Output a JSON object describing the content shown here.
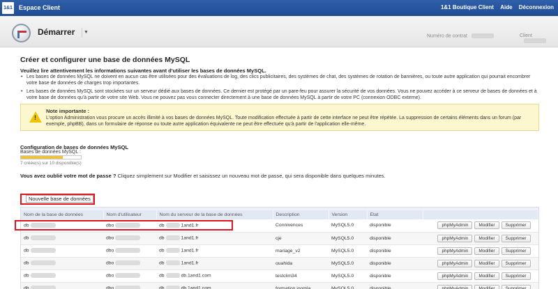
{
  "topbar": {
    "logo": "1&1",
    "title": "Espace Client",
    "links": [
      "1&1 Boutique Client",
      "Aide",
      "Déconnexion"
    ],
    "bg_color": "#1f4c95"
  },
  "header": {
    "start_label": "Démarrer",
    "contract_label": "Numéro de contrat",
    "client_label": "Client"
  },
  "main": {
    "title": "Créer et configurer une base de données MySQL",
    "warning_lead": "Veuillez lire attentivement les informations suivantes avant d'utiliser les bases de données MySQL.",
    "bullet1": "Les bases de données MySQL ne doivent en aucun cas être utilisées pour des évaluations de log, des clics publicitaires, des systèmes de chat, des systèmes de rotation de bannières, ou toute autre application qui pourrait encombrer votre base de données de charges trop importantes.",
    "bullet2": "Les bases de données MySQL sont stockées sur un serveur dédié aux bases de données. Ce dernier est protégé par un pare-feu pour assurer la sécurité de vos données. Vous ne pouvez accéder à ce serveur de bases de données et à votre base de données qu'à partir de votre site Web. Vous ne pouvez pas vous connecter directement à une base de données MySQL à partir de votre PC (connexion ODBC externe).",
    "note_title": "Note importante :",
    "note_text": "L'option Administration vous procure un accès illimité à vos bases de données MySQL. Toute modification effectuée à partir de cette interface ne peut être répétée. La suppression de certains éléments dans un forum (par exemple, phpBB), dans un formulaire de réponse ou toute autre application équivalente ne peut être effectuée qu'à partir de l'application elle-même.",
    "config_title": "Configuration de bases de données MySQL",
    "config_label": "Bases de données MySQL :",
    "config_count": "7 créée(s) sur 10 disponible(s)",
    "config_fill_fraction": 0.7,
    "forgot_question": "Vous avez oublié votre mot de passe ?",
    "forgot_text": "Cliquez simplement sur Modifier et saisissez un nouveau mot de passe, qui sera disponible dans quelques minutes.",
    "new_db_button": "Nouvelle base de données"
  },
  "table": {
    "headers": [
      "Nom de la base de données",
      "Nom d'utilisateur",
      "Nom du serveur de la base de données",
      "Description",
      "Version",
      "Etat",
      ""
    ],
    "rows": [
      {
        "db": "db",
        "user": "dbo",
        "server_prefix": "db",
        "server_suffix": "1and1.fr",
        "desc": "Connivences",
        "version": "MySQL5.0",
        "state": "disponible"
      },
      {
        "db": "db",
        "user": "dbo",
        "server_prefix": "db",
        "server_suffix": "1and1.fr",
        "desc": "cje",
        "version": "MySQL5.0",
        "state": "disponible"
      },
      {
        "db": "db",
        "user": "dbo",
        "server_prefix": "db",
        "server_suffix": "1and1.fr",
        "desc": "mariage_v2",
        "version": "MySQL5.0",
        "state": "disponible"
      },
      {
        "db": "db",
        "user": "dbo",
        "server_prefix": "db",
        "server_suffix": "1and1.fr",
        "desc": "ouahida",
        "version": "MySQL5.0",
        "state": "disponible"
      },
      {
        "db": "db",
        "user": "dbo",
        "server_prefix": "db",
        "server_suffix": "db.1and1.com",
        "desc": "testclim34",
        "version": "MySQL5.0",
        "state": "disponible"
      },
      {
        "db": "db",
        "user": "dbo",
        "server_prefix": "db",
        "server_suffix": "db.1and1.com",
        "desc": "formation joomla",
        "version": "MySQL5.0",
        "state": "disponible"
      }
    ],
    "actions": [
      "phpMyAdmin",
      "Modifier",
      "Supprimer"
    ]
  }
}
